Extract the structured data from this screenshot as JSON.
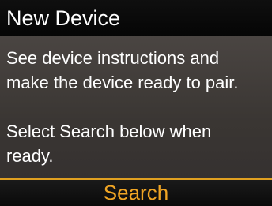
{
  "header": {
    "title": "New Device"
  },
  "message": {
    "lines": [
      "See device instructions and",
      "make the device ready to pair.",
      "Select Search below when",
      "ready."
    ]
  },
  "softkeys": {
    "primary_label": "Search"
  },
  "colors": {
    "accent": "#f0a524",
    "divider": "#e0a020",
    "content_background": "#3c3836",
    "bar_background": "#0a0a0a"
  }
}
